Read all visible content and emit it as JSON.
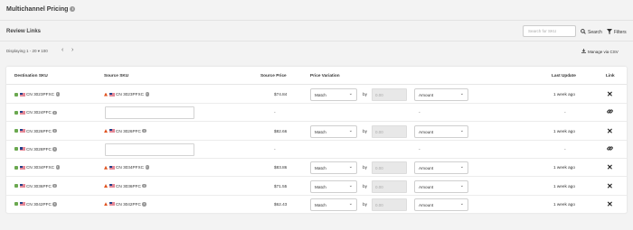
{
  "header": {
    "title": "Multichannel Pricing",
    "info_icon": "info-icon"
  },
  "toolbar": {
    "section_title": "Review Links",
    "search_placeholder": "Search for SKU",
    "search_label": "Search",
    "filters_label": "Filters"
  },
  "pager": {
    "display_text": "Displaying 1 - 20 ▾ 100",
    "manage_csv": "Manage via CSV"
  },
  "table": {
    "columns": {
      "dest": "Destination SKU",
      "src": "Source SKU",
      "price": "Source Price",
      "variation": "Price Variation",
      "update": "Last Update",
      "link": "Link"
    },
    "rows": [
      {
        "dest": "CN 3023PFXC",
        "src": "CN 3023PFXC",
        "price": "$74.84",
        "match": "Match",
        "by": "by",
        "amount_placeholder": "0.00",
        "amount": "Amount",
        "update": "1 week ago",
        "linked": true
      },
      {
        "dest": "CN 3024PFC",
        "src": "",
        "price": "-",
        "match": "",
        "by": "",
        "amount_placeholder": "",
        "amount": "-",
        "update": "-",
        "linked": false
      },
      {
        "dest": "CN 3026PFC",
        "src": "CN 3026PFC",
        "price": "$82.66",
        "match": "Match",
        "by": "by",
        "amount_placeholder": "0.00",
        "amount": "Amount",
        "update": "1 week ago",
        "linked": true
      },
      {
        "dest": "CN 3028PFC",
        "src": "",
        "price": "-",
        "match": "",
        "by": "",
        "amount_placeholder": "",
        "amount": "-",
        "update": "-",
        "linked": false
      },
      {
        "dest": "CN 3034PFXC",
        "src": "CN 3034PFXC",
        "price": "$83.86",
        "match": "Match",
        "by": "by",
        "amount_placeholder": "0.00",
        "amount": "Amount",
        "update": "1 week ago",
        "linked": true
      },
      {
        "dest": "CN 3036PFC",
        "src": "CN 3036PFC",
        "price": "$71.55",
        "match": "Match",
        "by": "by",
        "amount_placeholder": "0.00",
        "amount": "Amount",
        "update": "1 week ago",
        "linked": true
      },
      {
        "dest": "CN 3042PFC",
        "src": "CN 3042PFC",
        "price": "$62.43",
        "match": "Match",
        "by": "by",
        "amount_placeholder": "0.00",
        "amount": "Amount",
        "update": "1 week ago",
        "linked": true
      }
    ]
  }
}
